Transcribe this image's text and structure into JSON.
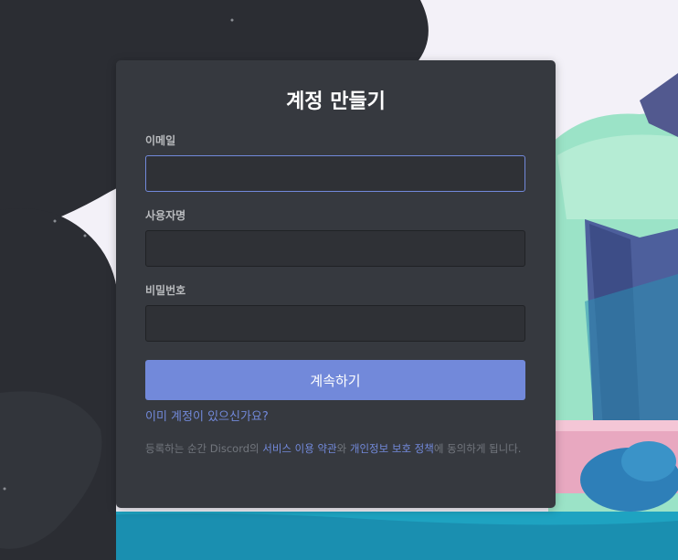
{
  "form": {
    "title": "계정 만들기",
    "email_label": "이메일",
    "email_value": "",
    "username_label": "사용자명",
    "username_value": "",
    "password_label": "비밀번호",
    "password_value": "",
    "submit_label": "계속하기",
    "login_link": "이미 계정이 있으신가요?",
    "terms": {
      "prefix": "등록하는 순간 Discord의 ",
      "tos_link": "서비스 이용 약관",
      "middle": "와 ",
      "privacy_link": "개인정보 보호 정책",
      "suffix": "에 동의하게 됩니다."
    }
  },
  "colors": {
    "card": "#36393f",
    "input_bg": "#2f3136",
    "accent": "#7289da",
    "label": "#b9bbbe",
    "muted": "#72767d"
  }
}
